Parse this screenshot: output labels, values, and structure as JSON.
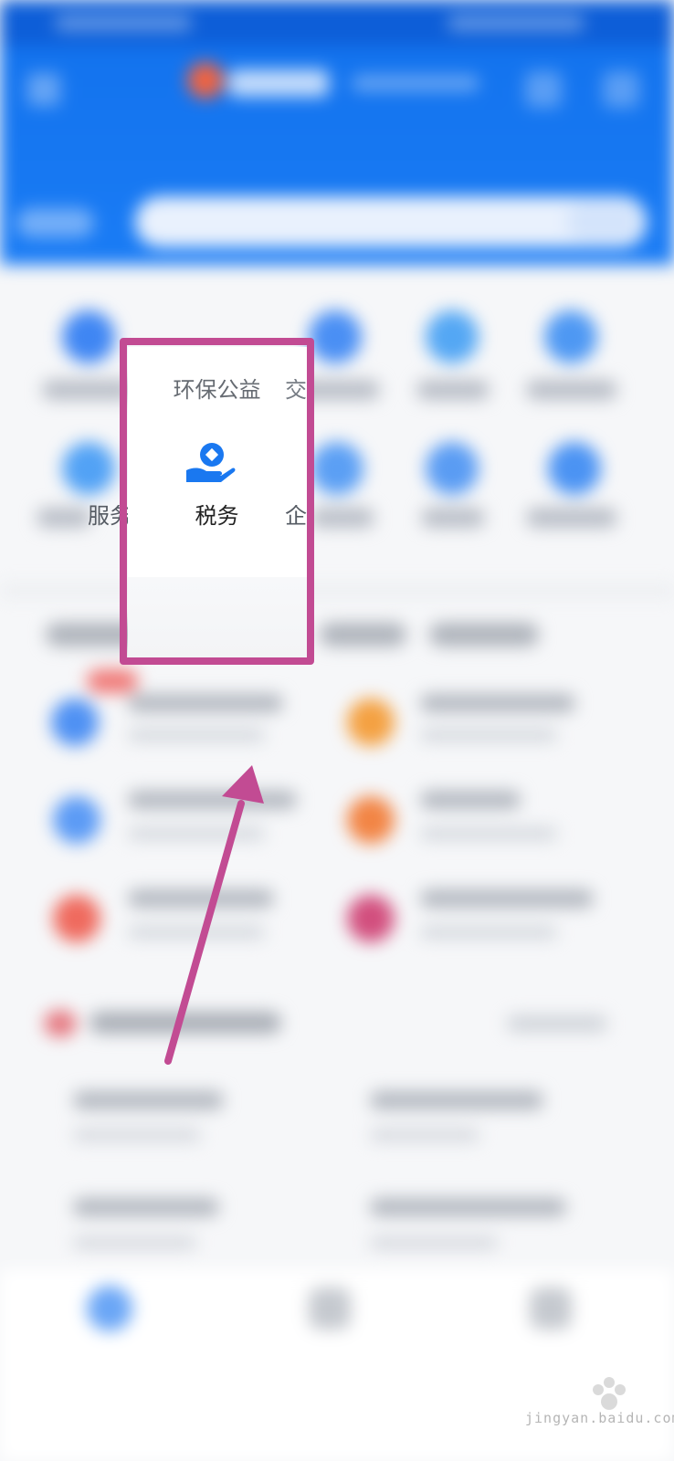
{
  "service_grid": {
    "row1_item_2_label": "环保公益",
    "row1_item_3_peek": "交",
    "row2_item_1_label_fragment": "服务",
    "row2_item_2_label": "税务",
    "row2_item_3_label_fragment": "企业服"
  },
  "watermark": {
    "text": "jingyan.baidu.com",
    "brand": "Baidu 经验"
  },
  "colors": {
    "header_blue": "#1373ee",
    "highlight_magenta": "#c24b93",
    "tax_icon_blue": "#1a78f0"
  }
}
